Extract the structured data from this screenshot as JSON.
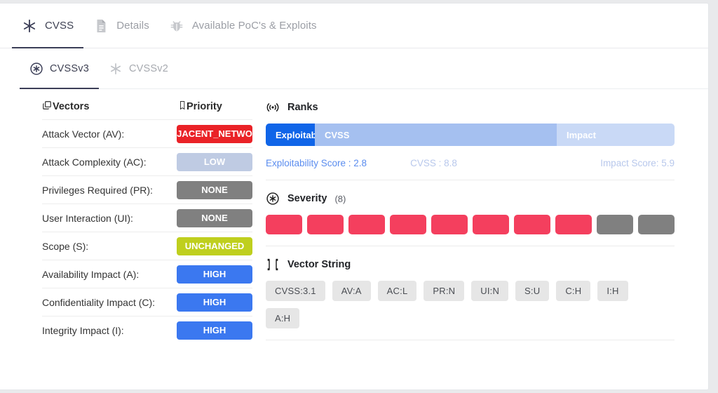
{
  "top_tabs": [
    {
      "label": "CVSS",
      "icon": "asterisk-icon",
      "active": true
    },
    {
      "label": "Details",
      "icon": "document-icon",
      "active": false
    },
    {
      "label": "Available PoC's & Exploits",
      "icon": "bug-icon",
      "active": false
    }
  ],
  "sub_tabs": [
    {
      "label": "CVSSv3",
      "icon": "circled-asterisk-icon",
      "active": true
    },
    {
      "label": "CVSSv2",
      "icon": "asterisk-icon",
      "active": false
    }
  ],
  "vectors": {
    "header": {
      "col1": "Vectors",
      "col2": "Priority",
      "col1_icon": "copy-layers-icon",
      "col2_icon": "book-icon"
    },
    "rows": [
      {
        "label": "Attack Vector (AV):",
        "value": "ADJACENT_NETWORK",
        "color": "#ea2227",
        "clipped": true
      },
      {
        "label": "Attack Complexity (AC):",
        "value": "LOW",
        "color": "#bfcbe3",
        "clipped": false
      },
      {
        "label": "Privileges Required (PR):",
        "value": "NONE",
        "color": "#808080",
        "clipped": false
      },
      {
        "label": "User Interaction (UI):",
        "value": "NONE",
        "color": "#808080",
        "clipped": false
      },
      {
        "label": "Scope (S):",
        "value": "UNCHANGED",
        "color": "#bfcf1e",
        "clipped": false
      },
      {
        "label": "Availability Impact (A):",
        "value": "HIGH",
        "color": "#3b78f0",
        "clipped": false
      },
      {
        "label": "Confidentiality Impact (C):",
        "value": "HIGH",
        "color": "#3b78f0",
        "clipped": false
      },
      {
        "label": "Integrity Impact (I):",
        "value": "HIGH",
        "color": "#3b78f0",
        "clipped": false
      }
    ]
  },
  "ranks": {
    "title": "Ranks",
    "icon": "broadcast-icon",
    "segments": [
      {
        "label": "Exploitability",
        "color": "#1065e8"
      },
      {
        "label": "CVSS",
        "color": "#a5c0f0"
      },
      {
        "label": "Impact",
        "color": "#c9d9f6"
      }
    ],
    "scores": {
      "exploitability": "Exploitability Score : 2.8",
      "cvss": "CVSS : 8.8",
      "impact": "Impact Score: 5.9"
    }
  },
  "severity": {
    "title": "Severity",
    "count_label": "(8)",
    "icon": "circled-asterisk-icon",
    "total_blocks": 10,
    "filled_blocks": 8,
    "filled_color": "#F43F5E",
    "empty_color": "#808080"
  },
  "vector_string": {
    "title": "Vector String",
    "icon": "crop-frame-icon",
    "chips": [
      "CVSS:3.1",
      "AV:A",
      "AC:L",
      "PR:N",
      "UI:N",
      "S:U",
      "C:H",
      "I:H",
      "A:H"
    ]
  }
}
